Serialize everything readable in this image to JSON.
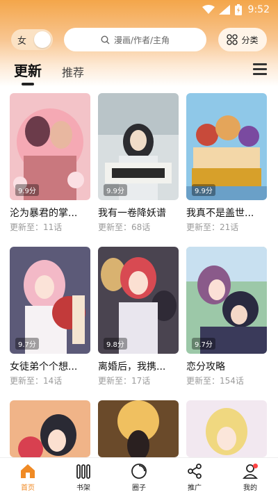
{
  "status_bar": {
    "time": "9:52"
  },
  "header": {
    "gender_toggle_label": "女",
    "search_placeholder": "漫画/作者/主角",
    "category_label": "分类"
  },
  "tabs": [
    {
      "label": "更新",
      "active": true
    },
    {
      "label": "推荐",
      "active": false
    }
  ],
  "comics": [
    {
      "title": "沦为暴君的掌...",
      "update_prefix": "更新至：",
      "update": "更新至：11话",
      "rating": "9.9分"
    },
    {
      "title": "我有一卷降妖谱",
      "update": "更新至：68话",
      "rating": "9.9分"
    },
    {
      "title": "我真不是盖世...",
      "update": "更新至：21话",
      "rating": "9.9分"
    },
    {
      "title": "女徒弟个个想...",
      "update": "更新至：14话",
      "rating": "9.7分"
    },
    {
      "title": "离婚后，我携...",
      "update": "更新至：17话",
      "rating": "9.8分"
    },
    {
      "title": "恋分攻略",
      "update": "更新至：154话",
      "rating": "9.7分"
    },
    {
      "title": "",
      "update": "",
      "rating": ""
    },
    {
      "title": "",
      "update": "",
      "rating": ""
    },
    {
      "title": "",
      "update": "",
      "rating": ""
    }
  ],
  "bottom_nav": [
    {
      "label": "首页",
      "icon": "home-icon",
      "active": true
    },
    {
      "label": "书架",
      "icon": "bookshelf-icon",
      "active": false
    },
    {
      "label": "圈子",
      "icon": "circle-icon",
      "active": false
    },
    {
      "label": "推广",
      "icon": "share-icon",
      "active": false
    },
    {
      "label": "我的",
      "icon": "user-icon",
      "active": false
    }
  ],
  "colors": {
    "accent": "#f08a24",
    "hero_top": "#f4a64a"
  }
}
